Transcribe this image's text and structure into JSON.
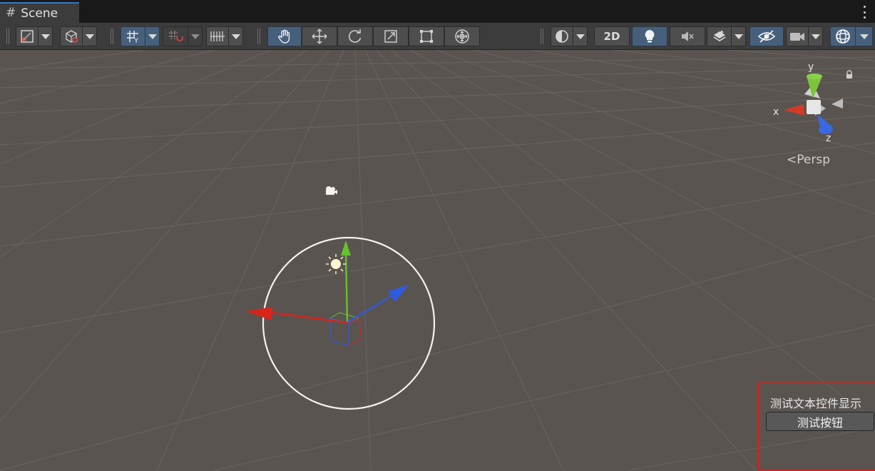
{
  "window": {
    "tab_icon": "#",
    "tab_label": "Scene",
    "menu_icon": "kebab-menu-icon"
  },
  "toolbar": {
    "left_tools": [
      {
        "icon": "gizmo-draw-mode-icon",
        "dropdown": true
      },
      {
        "icon": "render-shading-cube-icon",
        "dropdown": true
      },
      {
        "icon": "grid-snap-world-icon",
        "dropdown": true,
        "active": true
      },
      {
        "icon": "increment-snap-magnet-icon",
        "dropdown": true
      },
      {
        "icon": "grid-ruler-icon",
        "dropdown": true
      }
    ],
    "transform_tools": [
      {
        "icon": "hand-tool-icon",
        "active": true
      },
      {
        "icon": "move-tool-icon"
      },
      {
        "icon": "rotate-tool-icon"
      },
      {
        "icon": "scale-tool-icon"
      },
      {
        "icon": "rect-tool-icon"
      },
      {
        "icon": "transform-tool-icon"
      }
    ],
    "right_tools": [
      {
        "icon": "draw-mode-sphere-icon",
        "dropdown": true
      },
      {
        "label": "2D"
      },
      {
        "icon": "lighting-bulb-icon",
        "active": true
      },
      {
        "icon": "audio-mute-icon"
      },
      {
        "icon": "effects-layers-icon",
        "dropdown": true
      },
      {
        "icon": "scene-visibility-eye-icon",
        "active": true
      },
      {
        "icon": "scene-camera-icon",
        "dropdown": true
      },
      {
        "icon": "gizmos-sphere-icon",
        "dropdown": true,
        "active": true
      }
    ],
    "label_2d": "2D"
  },
  "scene": {
    "orientation_gizmo": {
      "y": "y",
      "x": "x",
      "z": "z",
      "projection": "Persp"
    },
    "colors": {
      "background": "#5a5450",
      "x_axis": "#d8241c",
      "y_axis": "#63c32e",
      "z_axis": "#2f5be0",
      "selection_circle": "#f2f2f2",
      "highlight_box": "#e01c1c"
    }
  },
  "overlay": {
    "label_text": "测试文本控件显示",
    "button_label": "测试按钮"
  }
}
